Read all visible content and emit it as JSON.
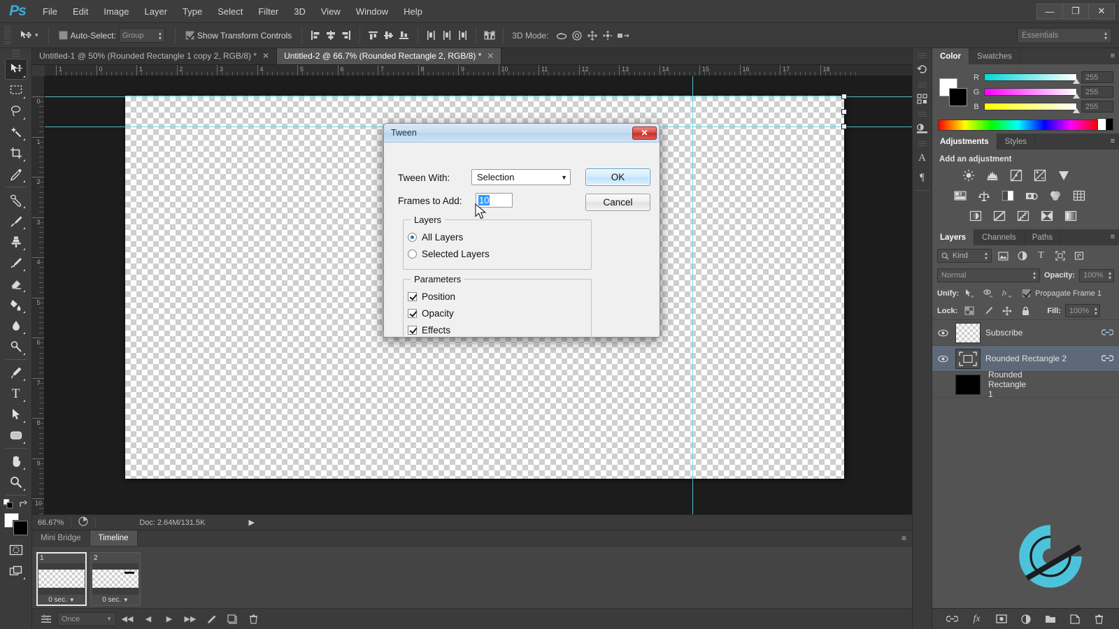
{
  "app": {
    "logo": "Ps",
    "menus": [
      "File",
      "Edit",
      "Image",
      "Layer",
      "Type",
      "Select",
      "Filter",
      "3D",
      "View",
      "Window",
      "Help"
    ],
    "window_buttons": [
      {
        "name": "minimize",
        "glyph": "—"
      },
      {
        "name": "restore",
        "glyph": "❐"
      },
      {
        "name": "close",
        "glyph": "✕"
      }
    ]
  },
  "options_bar": {
    "tool_icon": "move-tool-icon",
    "auto_select_label": "Auto-Select:",
    "auto_select_checked": false,
    "auto_select_scope": "Group",
    "show_transform_label": "Show Transform Controls",
    "show_transform_checked": true,
    "align_icons": [
      "align-left-edges-icon",
      "align-horizontal-centers-icon",
      "align-right-edges-icon",
      "align-top-edges-icon",
      "align-vertical-centers-icon",
      "align-bottom-edges-icon",
      "distribute-left-icon",
      "distribute-horizontal-center-icon",
      "distribute-right-icon",
      "auto-align-layers-icon"
    ],
    "mode_3d_label": "3D Mode:",
    "mode_3d_icons": [
      "rotate-3d-icon",
      "roll-3d-icon",
      "drag-3d-icon",
      "slide-3d-icon",
      "scale-3d-icon"
    ],
    "workspace": "Essentials"
  },
  "toolbar": {
    "tools": [
      {
        "name": "move-tool",
        "glyph": "move",
        "active": true
      },
      {
        "name": "rectangular-marquee-tool",
        "glyph": "marquee"
      },
      {
        "name": "lasso-tool",
        "glyph": "lasso"
      },
      {
        "name": "quick-selection-tool",
        "glyph": "wand"
      },
      {
        "name": "crop-tool",
        "glyph": "crop"
      },
      {
        "name": "eyedropper-tool",
        "glyph": "eyedropper"
      },
      {
        "name": "spot-healing-brush-tool",
        "glyph": "heal"
      },
      {
        "name": "brush-tool",
        "glyph": "brush"
      },
      {
        "name": "clone-stamp-tool",
        "glyph": "stamp"
      },
      {
        "name": "history-brush-tool",
        "glyph": "historybrush"
      },
      {
        "name": "eraser-tool",
        "glyph": "eraser"
      },
      {
        "name": "gradient-tool",
        "glyph": "paintbucket"
      },
      {
        "name": "blur-tool",
        "glyph": "blur"
      },
      {
        "name": "dodge-tool",
        "glyph": "dodge"
      },
      {
        "name": "pen-tool",
        "glyph": "pen"
      },
      {
        "name": "horizontal-type-tool",
        "glyph": "type"
      },
      {
        "name": "path-selection-tool",
        "glyph": "pathselect"
      },
      {
        "name": "rounded-rectangle-tool",
        "glyph": "shape"
      },
      {
        "name": "hand-tool",
        "glyph": "hand"
      },
      {
        "name": "zoom-tool",
        "glyph": "zoom"
      }
    ],
    "foreground_color": "#ffffff",
    "background_color": "#000000",
    "quick_mask_name": "quick-mask-mode",
    "screen_mode_name": "screen-mode"
  },
  "documents": {
    "tabs": [
      {
        "label": "Untitled-1 @ 50% (Rounded Rectangle 1 copy 2, RGB/8) *",
        "active": false
      },
      {
        "label": "Untitled-2 @ 66.7% (Rounded Rectangle 2, RGB/8) *",
        "active": true
      }
    ],
    "ruler_h": [
      "1",
      "0",
      "1",
      "2",
      "3",
      "4",
      "5",
      "6",
      "7",
      "8",
      "9",
      "10",
      "11",
      "12",
      "13",
      "14",
      "15",
      "16",
      "17",
      "18"
    ],
    "ruler_v": [
      "0",
      "1",
      "2",
      "3",
      "4",
      "5",
      "6",
      "7",
      "8",
      "9",
      "10"
    ]
  },
  "status_bar": {
    "zoom": "66.67%",
    "doc_info": "Doc: 2.64M/131.5K",
    "play_icon": "play-arrow-icon",
    "thumb_icon": "document-proxy-icon"
  },
  "timeline": {
    "tabs": [
      {
        "label": "Mini Bridge",
        "active": false
      },
      {
        "label": "Timeline",
        "active": true
      }
    ],
    "frames": [
      {
        "number": "1",
        "delay": "0 sec.",
        "selected": true
      },
      {
        "number": "2",
        "delay": "0 sec.",
        "selected": false
      }
    ],
    "loop_option": "Once",
    "controls": [
      {
        "name": "tween-animation-frames-button",
        "glyph": "tween"
      },
      {
        "name": "select-first-frame-button",
        "glyph": "first"
      },
      {
        "name": "select-previous-frame-button",
        "glyph": "prev"
      },
      {
        "name": "play-animation-button",
        "glyph": "play"
      },
      {
        "name": "select-next-frame-button",
        "glyph": "next"
      },
      {
        "name": "tweens-animation-frames-button",
        "glyph": "tweenpencil"
      },
      {
        "name": "duplicate-selected-frames-button",
        "glyph": "duplicate"
      },
      {
        "name": "delete-selected-frames-button",
        "glyph": "trash"
      }
    ]
  },
  "dock_mini": {
    "icons": [
      {
        "name": "history-panel-icon",
        "glyph": "↺"
      },
      {
        "name": "properties-panel-icon",
        "glyph": "▤"
      },
      {
        "name": "actions-panel-icon",
        "glyph": "▦"
      },
      {
        "name": "character-panel-icon",
        "glyph": "A"
      },
      {
        "name": "paragraph-panel-icon",
        "glyph": "¶"
      }
    ]
  },
  "color_panel": {
    "tabs": [
      {
        "label": "Color",
        "active": true
      },
      {
        "label": "Swatches",
        "active": false
      }
    ],
    "foreground": "#ffffff",
    "background": "#000000",
    "channels": [
      {
        "label": "R",
        "value": "255",
        "from": "#00d8d8",
        "to": "#ffffff"
      },
      {
        "label": "G",
        "value": "255",
        "from": "#ff00ff",
        "to": "#ffffff"
      },
      {
        "label": "B",
        "value": "255",
        "from": "#ffff00",
        "to": "#ffffff"
      }
    ]
  },
  "adjustments_panel": {
    "tabs": [
      {
        "label": "Adjustments",
        "active": true
      },
      {
        "label": "Styles",
        "active": false
      }
    ],
    "title": "Add an adjustment",
    "rows": [
      [
        "brightness-contrast-icon",
        "levels-icon",
        "curves-icon",
        "exposure-icon",
        "vibrance-icon"
      ],
      [
        "hue-saturation-icon",
        "color-balance-icon",
        "black-white-icon",
        "photo-filter-icon",
        "channel-mixer-icon",
        "color-lookup-icon"
      ],
      [
        "invert-icon",
        "posterize-icon",
        "threshold-icon",
        "selective-color-icon",
        "gradient-map-icon"
      ]
    ]
  },
  "layers_panel": {
    "tabs": [
      {
        "label": "Layers",
        "active": true
      },
      {
        "label": "Channels",
        "active": false
      },
      {
        "label": "Paths",
        "active": false
      }
    ],
    "filter_kind": "Kind",
    "filter_icons": [
      "filter-pixel-icon",
      "filter-adjustment-icon",
      "filter-type-icon",
      "filter-shape-icon",
      "filter-smart-object-icon"
    ],
    "blend_mode": "Normal",
    "opacity_label": "Opacity:",
    "opacity_value": "100%",
    "unify_label": "Unify:",
    "unify_icons": [
      "unify-position-icon",
      "unify-visibility-icon",
      "unify-style-icon"
    ],
    "propagate_label": "Propagate Frame 1",
    "propagate_checked": true,
    "lock_label": "Lock:",
    "lock_icons": [
      "lock-transparent-pixels-icon",
      "lock-image-pixels-icon",
      "lock-position-icon",
      "lock-all-icon"
    ],
    "fill_label": "Fill:",
    "fill_value": "100%",
    "layers": [
      {
        "name": "Subscribe",
        "visible": true,
        "selected": false,
        "thumb": "checker",
        "linked": true
      },
      {
        "name": "Rounded Rectangle 2",
        "visible": true,
        "selected": true,
        "thumb": "vector",
        "linked": true
      },
      {
        "name": "Rounded Rectangle 1",
        "visible": false,
        "selected": false,
        "thumb": "solid",
        "linked": false
      }
    ],
    "bottom_icons": [
      {
        "name": "link-layers-button",
        "glyph": "link"
      },
      {
        "name": "add-layer-style-button",
        "glyph": "fx"
      },
      {
        "name": "add-layer-mask-button",
        "glyph": "mask"
      },
      {
        "name": "new-fill-adjustment-layer-button",
        "glyph": "halfcircle"
      },
      {
        "name": "new-group-button",
        "glyph": "folder"
      },
      {
        "name": "new-layer-button",
        "glyph": "newlayer"
      },
      {
        "name": "delete-layer-button",
        "glyph": "trash"
      }
    ]
  },
  "dialog": {
    "title": "Tween",
    "close_glyph": "✕",
    "tween_with_label": "Tween With:",
    "tween_with_value": "Selection",
    "frames_to_add_label": "Frames to Add:",
    "frames_to_add_value": "10",
    "ok_label": "OK",
    "cancel_label": "Cancel",
    "layers_legend": "Layers",
    "layers_options": [
      {
        "label": "All Layers",
        "selected": true
      },
      {
        "label": "Selected Layers",
        "selected": false
      }
    ],
    "parameters_legend": "Parameters",
    "parameters": [
      {
        "label": "Position",
        "checked": true
      },
      {
        "label": "Opacity",
        "checked": true
      },
      {
        "label": "Effects",
        "checked": true
      }
    ]
  },
  "watermark": {
    "name": "g-logo-watermark",
    "color": "#4cc3da"
  }
}
